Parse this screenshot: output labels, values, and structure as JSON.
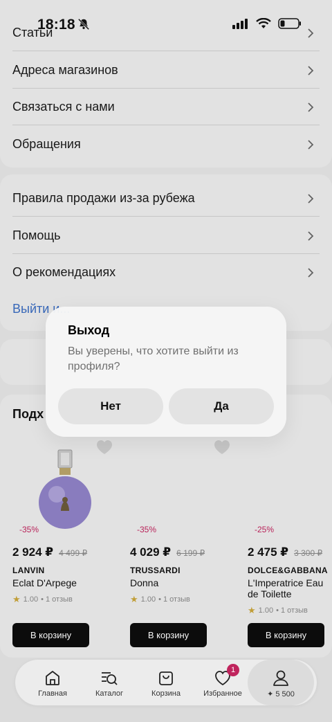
{
  "status_bar": {
    "time": "18:18"
  },
  "menu_top": [
    {
      "label": "Статьи"
    },
    {
      "label": "Адреса магазинов"
    },
    {
      "label": "Связаться с нами"
    },
    {
      "label": "Обращения"
    }
  ],
  "menu_rules": [
    {
      "label": "Правила продажи из-за рубежа"
    },
    {
      "label": "Помощь"
    },
    {
      "label": "О рекомендациях"
    }
  ],
  "logout_link": "Выйти и...",
  "products_section_title": "Подх",
  "products": [
    {
      "discount": "-35%",
      "price": "2 924 ₽",
      "old_price": "4 499 ₽",
      "brand": "LANVIN",
      "name": "Eclat D'Arpege",
      "rating": "1.00",
      "reviews": "• 1 отзыв",
      "cart_label": "В корзину"
    },
    {
      "discount": "-35%",
      "price": "4 029 ₽",
      "old_price": "6 199 ₽",
      "brand": "TRUSSARDI",
      "name": "Donna",
      "rating": "1.00",
      "reviews": "• 1 отзыв",
      "cart_label": "В корзину"
    },
    {
      "discount": "-25%",
      "price": "2 475 ₽",
      "old_price": "3 300 ₽",
      "brand": "DOLCE&GABBANA",
      "name": "L'Imperatrice Eau de Toilette",
      "rating": "1.00",
      "reviews": "• 1 отзыв",
      "cart_label": "В корзину"
    }
  ],
  "dialog": {
    "title": "Выход",
    "message": "Вы уверены, что хотите выйти из профиля?",
    "cancel_label": "Нет",
    "confirm_label": "Да"
  },
  "tabbar": {
    "home": "Главная",
    "catalog": "Каталог",
    "cart": "Корзина",
    "favorites": "Избранное",
    "favorites_badge": "1",
    "profile": "✦ 5 500"
  },
  "colors": {
    "accent_discount": "#c0245d",
    "link": "#3a6cc0",
    "button_dark": "#0d0d0d"
  }
}
